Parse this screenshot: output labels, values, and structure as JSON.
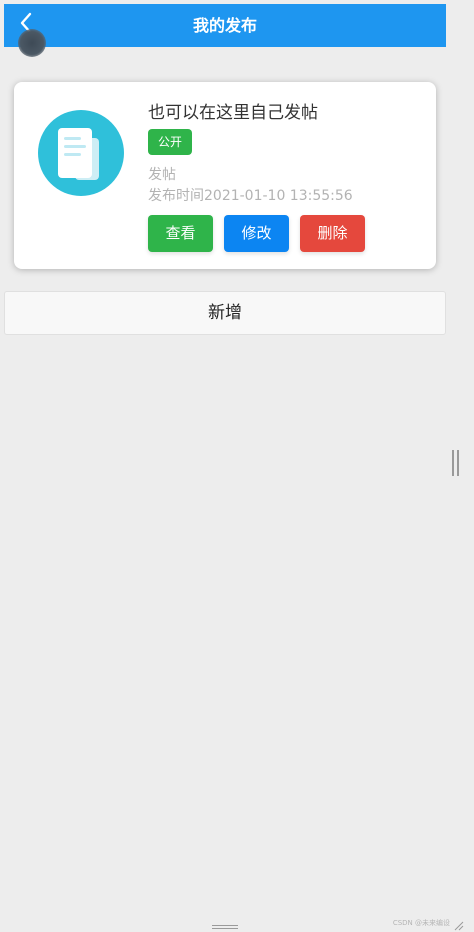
{
  "header": {
    "title": "我的发布",
    "back_icon": "chevron-left-icon",
    "color": "#1e96f0"
  },
  "post": {
    "icon": "document-icon",
    "icon_color": "#2fc0da",
    "title": "也可以在这里自己发帖",
    "badge": "公开",
    "category": "发帖",
    "time": "发布时间2021-01-10 13:55:56",
    "actions": {
      "view": "查看",
      "edit": "修改",
      "delete": "删除"
    },
    "colors": {
      "view": "#2fb44a",
      "edit": "#0c85f2",
      "delete": "#e5483d"
    }
  },
  "add_button": "新增",
  "watermark": "CSDN @未来编设"
}
